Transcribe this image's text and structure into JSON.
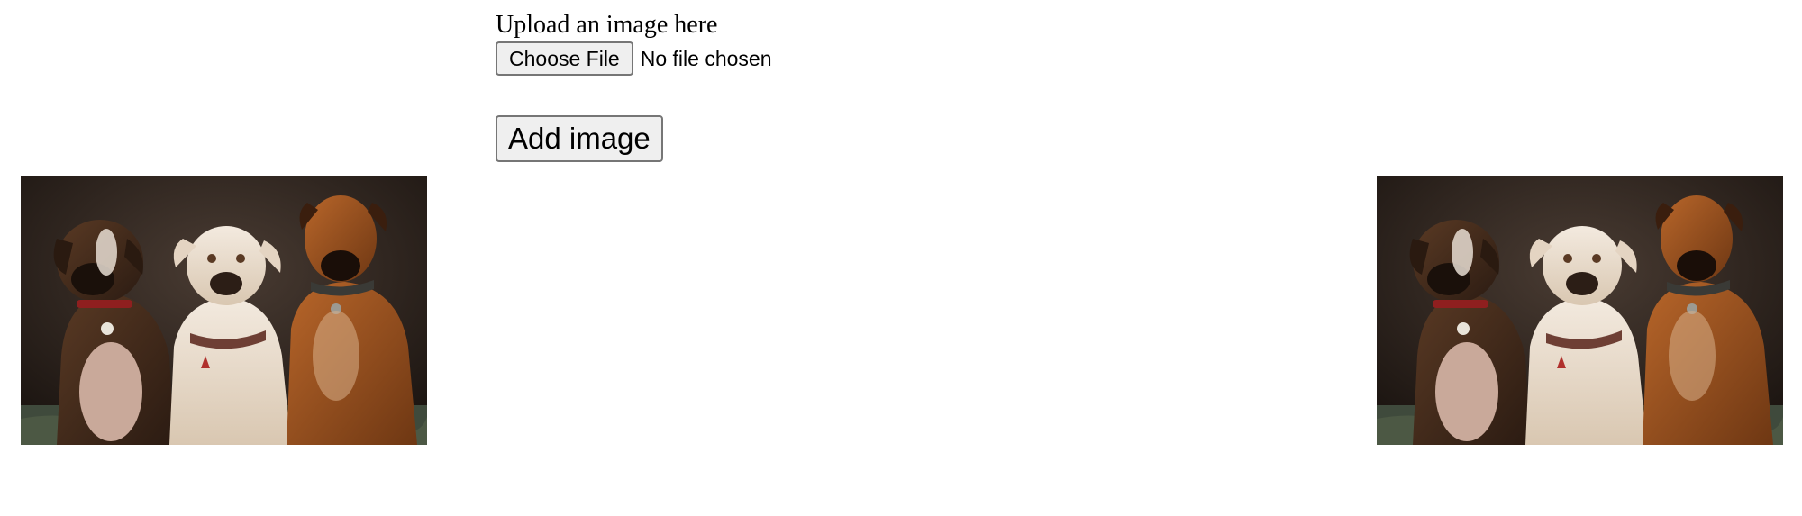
{
  "upload": {
    "label": "Upload an image here",
    "choose_file_label": "Choose File",
    "file_status": "No file chosen"
  },
  "actions": {
    "add_image_label": "Add image"
  },
  "images": [
    {
      "subject": "three-dogs-photo"
    },
    {
      "subject": "three-dogs-photo"
    }
  ]
}
